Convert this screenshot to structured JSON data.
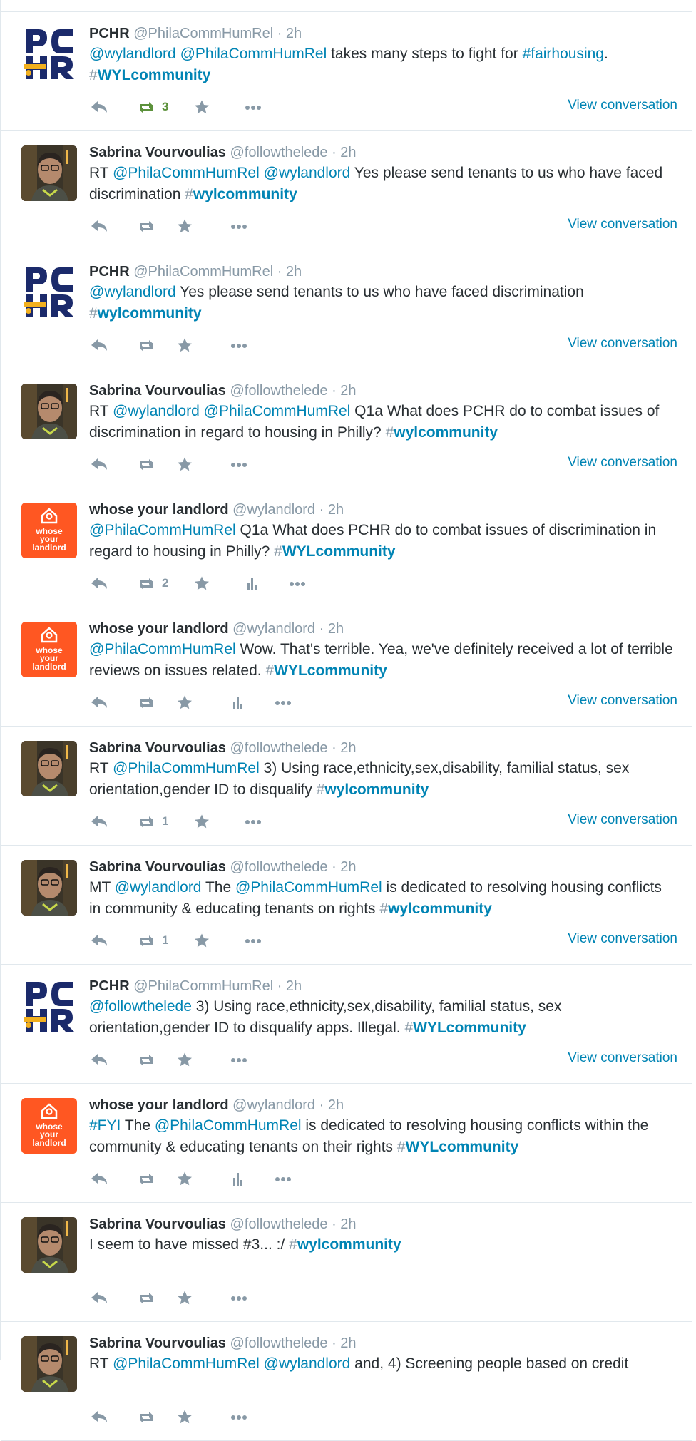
{
  "colors": {
    "link": "#0084b4",
    "muted": "#8899a6",
    "text": "#292f33",
    "retweeted": "#5c913b",
    "wyl_orange": "#ff5722",
    "pchr_navy": "#1b2a6b",
    "pchr_yellow": "#f2b01e"
  },
  "icons": {
    "reply": "reply-arrow-icon",
    "retweet": "retweet-arrows-icon",
    "favorite": "star-icon",
    "analytics": "bar-chart-icon",
    "more": "ellipsis-icon"
  },
  "avatars": {
    "pchr_logo_text": "PCHR",
    "wyl_logo_line1": "whose",
    "wyl_logo_line2": "your",
    "wyl_logo_line3": "landlord"
  },
  "tweets": [
    {
      "name": "PCHR",
      "handle": "@PhilaCommHumRel",
      "time": "· 2h",
      "segs": [
        [
          "@wylandlord",
          "link"
        ],
        [
          " ",
          "plain"
        ],
        [
          "@PhilaCommHumRel",
          "link"
        ],
        [
          " takes many steps to fight for ",
          "plain"
        ],
        [
          "#fairhousing",
          "link"
        ],
        [
          ". ",
          "plain"
        ],
        [
          "#",
          "hash"
        ],
        [
          "WYLcommunity",
          "tagb"
        ]
      ],
      "retweets": "3",
      "favorites": "",
      "retweeted": true,
      "analytics": false,
      "view": "View conversation"
    },
    {
      "name": "Sabrina Vourvoulias",
      "handle": "@followthelede",
      "time": "· 2h",
      "segs": [
        [
          "RT ",
          "plain"
        ],
        [
          "@PhilaCommHumRel",
          "link"
        ],
        [
          " ",
          "plain"
        ],
        [
          "@wylandlord",
          "link"
        ],
        [
          " Yes please send tenants to us who have faced discrimination ",
          "plain"
        ],
        [
          "#",
          "hash"
        ],
        [
          "wylcommunity",
          "tagb"
        ]
      ],
      "retweets": "",
      "favorites": "",
      "retweeted": false,
      "analytics": false,
      "view": "View conversation"
    },
    {
      "name": "PCHR",
      "handle": "@PhilaCommHumRel",
      "time": "· 2h",
      "segs": [
        [
          "@wylandlord",
          "link"
        ],
        [
          " Yes please send tenants to us who have faced discrimination ",
          "plain"
        ],
        [
          "#",
          "hash"
        ],
        [
          "wylcommunity",
          "tagb"
        ]
      ],
      "retweets": "",
      "favorites": "",
      "retweeted": false,
      "analytics": false,
      "view": "View conversation"
    },
    {
      "name": "Sabrina Vourvoulias",
      "handle": "@followthelede",
      "time": "· 2h",
      "segs": [
        [
          "RT ",
          "plain"
        ],
        [
          "@wylandlord",
          "link"
        ],
        [
          " ",
          "plain"
        ],
        [
          "@PhilaCommHumRel",
          "link"
        ],
        [
          " Q1a What does PCHR do to combat issues of discrimination in regard to housing in Philly?  ",
          "plain"
        ],
        [
          "#",
          "hash"
        ],
        [
          "wylcommunity",
          "tagb"
        ]
      ],
      "retweets": "",
      "favorites": "",
      "retweeted": false,
      "analytics": false,
      "view": "View conversation"
    },
    {
      "name": "whose your landlord",
      "handle": "@wylandlord",
      "time": "· 2h",
      "segs": [
        [
          "@PhilaCommHumRel",
          "link"
        ],
        [
          " Q1a What does PCHR do to combat issues of discrimination in regard to housing in Philly? ",
          "plain"
        ],
        [
          "#",
          "hash"
        ],
        [
          "WYLcommunity",
          "tagb"
        ]
      ],
      "retweets": "2",
      "favorites": "",
      "retweeted": false,
      "analytics": true,
      "view": ""
    },
    {
      "name": "whose your landlord",
      "handle": "@wylandlord",
      "time": "· 2h",
      "segs": [
        [
          "@PhilaCommHumRel",
          "link"
        ],
        [
          " Wow. That's terrible. Yea, we've definitely received a lot of terrible reviews on issues related. ",
          "plain"
        ],
        [
          "#",
          "hash"
        ],
        [
          "WYLcommunity",
          "tagb"
        ]
      ],
      "retweets": "",
      "favorites": "",
      "retweeted": false,
      "analytics": true,
      "view": "View conversation"
    },
    {
      "name": "Sabrina Vourvoulias",
      "handle": "@followthelede",
      "time": "· 2h",
      "segs": [
        [
          "RT ",
          "plain"
        ],
        [
          "@PhilaCommHumRel",
          "link"
        ],
        [
          " 3) Using race,ethnicity,sex,disability, familial status, sex orientation,gender ID to disqualify ",
          "plain"
        ],
        [
          "#",
          "hash"
        ],
        [
          "wylcommunity",
          "tagb"
        ]
      ],
      "retweets": "1",
      "favorites": "",
      "retweeted": false,
      "analytics": false,
      "view": "View conversation"
    },
    {
      "name": "Sabrina Vourvoulias",
      "handle": "@followthelede",
      "time": "· 2h",
      "segs": [
        [
          "MT ",
          "plain"
        ],
        [
          "@wylandlord",
          "link"
        ],
        [
          " The ",
          "plain"
        ],
        [
          "@PhilaCommHumRel",
          "link"
        ],
        [
          " is dedicated to resolving housing conflicts in community & educating tenants on rights ",
          "plain"
        ],
        [
          "#",
          "hash"
        ],
        [
          "wylcommunity",
          "tagb"
        ]
      ],
      "retweets": "1",
      "favorites": "",
      "retweeted": false,
      "analytics": false,
      "view": "View conversation"
    },
    {
      "name": "PCHR",
      "handle": "@PhilaCommHumRel",
      "time": "· 2h",
      "segs": [
        [
          "@followthelede",
          "link"
        ],
        [
          " 3) Using race,ethnicity,sex,disability, familial status, sex orientation,gender ID to disqualify apps. Illegal. ",
          "plain"
        ],
        [
          "#",
          "hash"
        ],
        [
          "WYLcommunity",
          "tagb"
        ]
      ],
      "retweets": "",
      "favorites": "",
      "retweeted": false,
      "analytics": false,
      "view": "View conversation"
    },
    {
      "name": "whose your landlord",
      "handle": "@wylandlord",
      "time": "· 2h",
      "segs": [
        [
          "#FYI",
          "link"
        ],
        [
          " The ",
          "plain"
        ],
        [
          "@PhilaCommHumRel",
          "link"
        ],
        [
          " is dedicated to resolving housing conflicts within the community & educating tenants on their rights ",
          "plain"
        ],
        [
          "#",
          "hash"
        ],
        [
          "WYLcommunity",
          "tagb"
        ]
      ],
      "retweets": "",
      "favorites": "",
      "retweeted": false,
      "analytics": true,
      "view": ""
    },
    {
      "name": "Sabrina Vourvoulias",
      "handle": "@followthelede",
      "time": "· 2h",
      "segs": [
        [
          "I seem to have missed #3... :/ ",
          "plain"
        ],
        [
          "#",
          "hash"
        ],
        [
          "wylcommunity",
          "tagb"
        ]
      ],
      "retweets": "",
      "favorites": "",
      "retweeted": false,
      "analytics": false,
      "view": ""
    },
    {
      "name": "Sabrina Vourvoulias",
      "handle": "@followthelede",
      "time": "· 2h",
      "segs": [
        [
          "RT ",
          "plain"
        ],
        [
          "@PhilaCommHumRel",
          "link"
        ],
        [
          " ",
          "plain"
        ],
        [
          "@wylandlord",
          "link"
        ],
        [
          " and, 4) Screening people based on credit",
          "plain"
        ]
      ],
      "retweets": "",
      "favorites": "",
      "retweeted": false,
      "analytics": false,
      "view": ""
    }
  ]
}
